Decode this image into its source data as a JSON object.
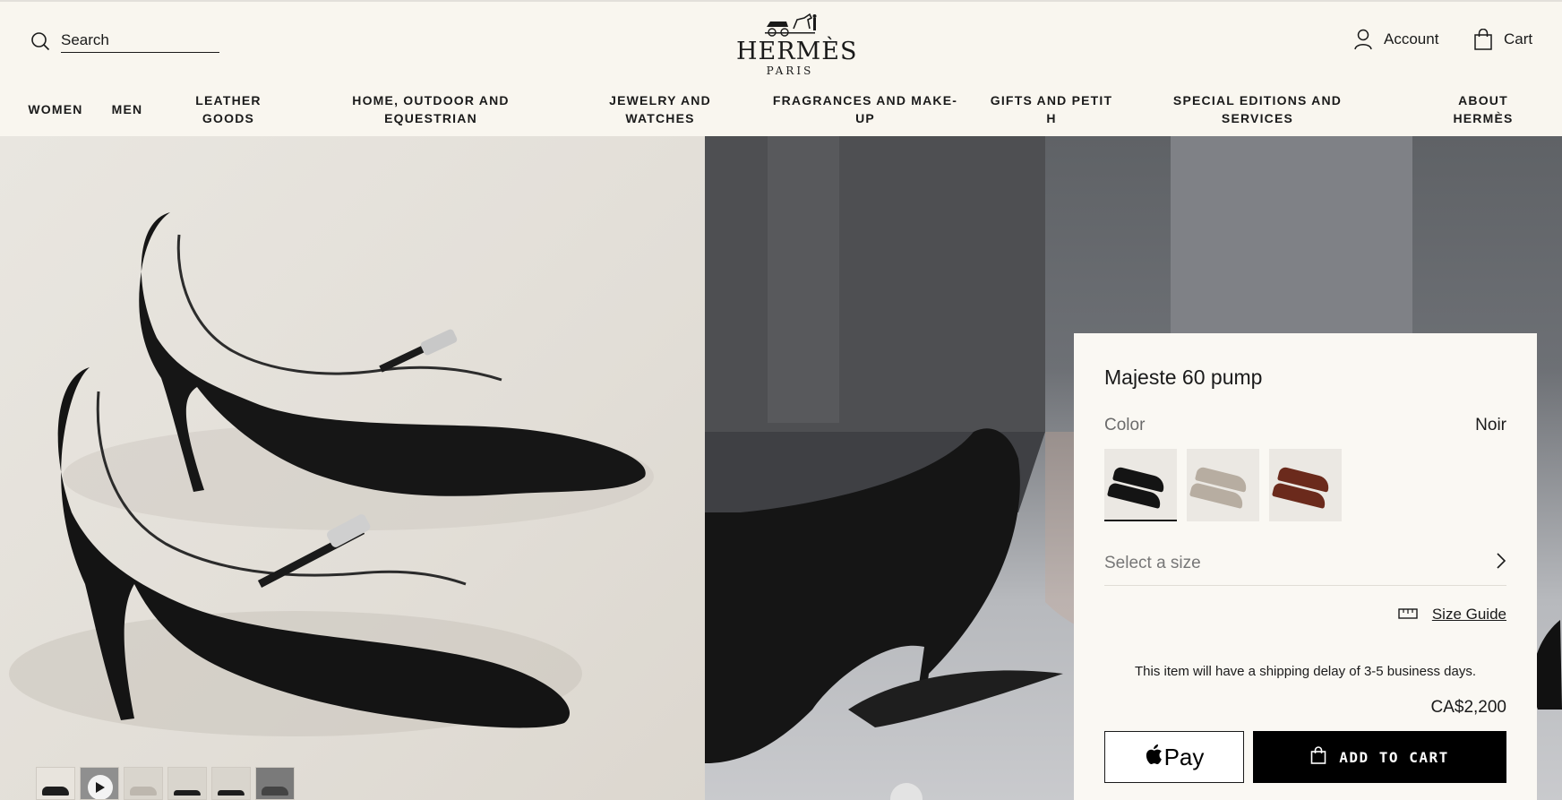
{
  "header": {
    "search_placeholder": "Search",
    "logo_word": "HERMÈS",
    "logo_city": "PARIS",
    "account_label": "Account",
    "cart_label": "Cart"
  },
  "nav": [
    {
      "line1": "WOMEN",
      "line2": ""
    },
    {
      "line1": "MEN",
      "line2": ""
    },
    {
      "line1": "LEATHER",
      "line2": "GOODS"
    },
    {
      "line1": "HOME, OUTDOOR AND",
      "line2": "EQUESTRIAN"
    },
    {
      "line1": "JEWELRY AND",
      "line2": "WATCHES"
    },
    {
      "line1": "FRAGRANCES AND MAKE-",
      "line2": "UP"
    },
    {
      "line1": "GIFTS AND PETIT",
      "line2": "H"
    },
    {
      "line1": "SPECIAL EDITIONS AND",
      "line2": "SERVICES"
    },
    {
      "line1": "ABOUT",
      "line2": "HERMÈS"
    }
  ],
  "product": {
    "title": "Majeste 60 pump",
    "color_label": "Color",
    "color_value": "Noir",
    "swatches": [
      {
        "name": "Noir",
        "bg": "#ece9e4",
        "shoe": "#141414"
      },
      {
        "name": "Beige",
        "bg": "#ece9e4",
        "shoe": "#b7ada1"
      },
      {
        "name": "Brown",
        "bg": "#ece9e4",
        "shoe": "#6b2a1c"
      }
    ],
    "size_placeholder": "Select a size",
    "size_guide_label": "Size Guide",
    "shipping_note": "This item will have a shipping delay of 3-5 business days.",
    "price": "CA$2,200",
    "apple_pay_label": "Pay",
    "add_to_cart_label": "ADD TO CART"
  },
  "colors": {
    "background": "#f9f6ef",
    "panel": "#faf8f3",
    "button_dark": "#000000",
    "text": "#1a1a1a"
  }
}
